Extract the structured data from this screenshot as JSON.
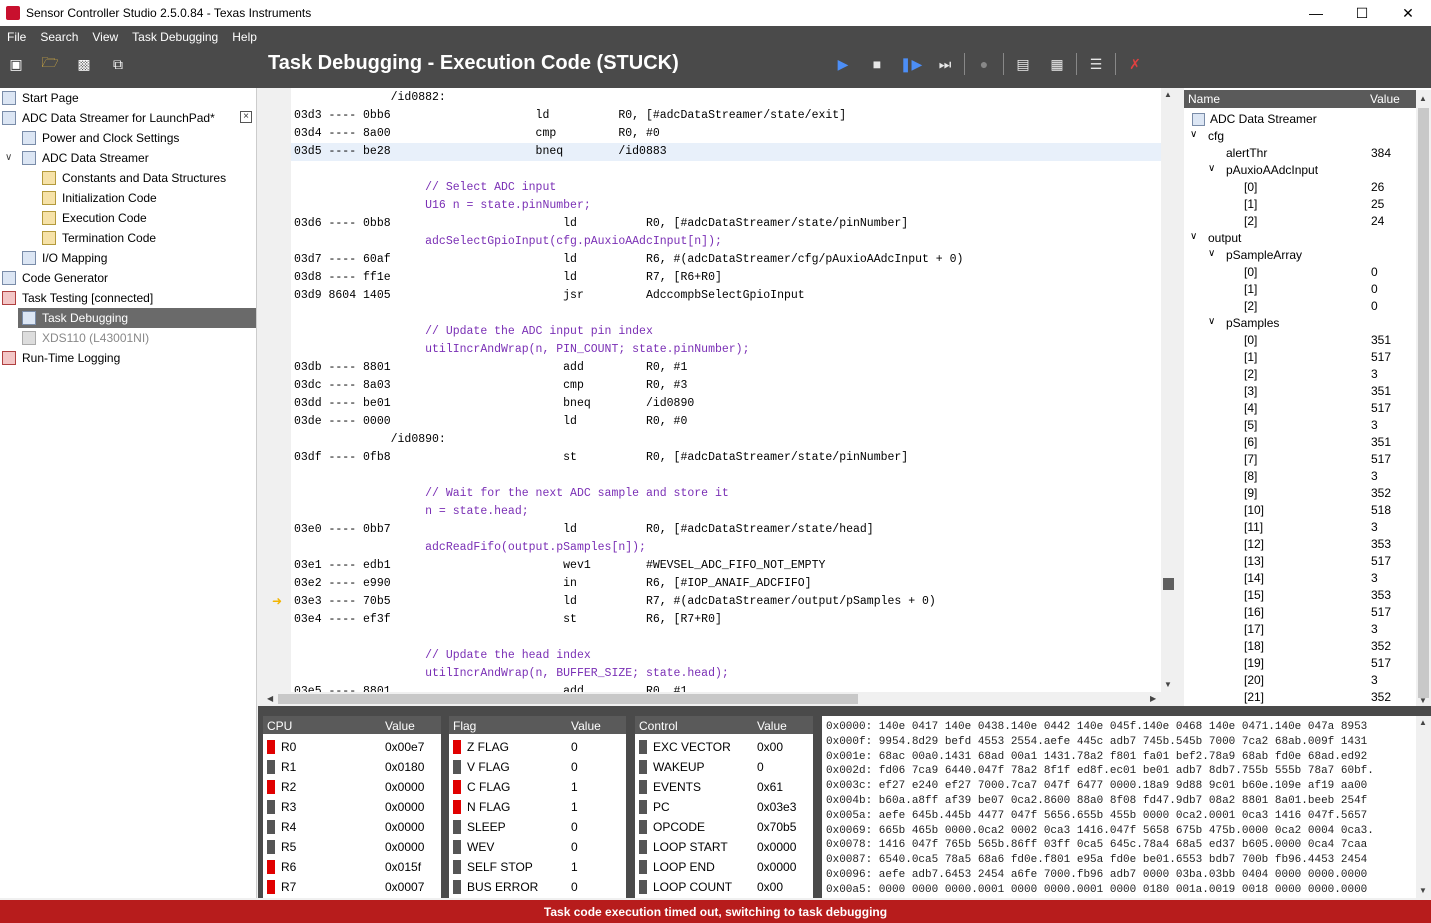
{
  "window": {
    "title": "Sensor Controller Studio 2.5.0.84 - Texas Instruments"
  },
  "menu": [
    "File",
    "Search",
    "View",
    "Task Debugging",
    "Help"
  ],
  "page_title": "Task Debugging - Execution Code (STUCK)",
  "tree": [
    {
      "label": "Start Page",
      "icon": "page-icon"
    },
    {
      "label": "ADC Data Streamer for LaunchPad*",
      "icon": "project-icon"
    },
    {
      "label": "Power and Clock Settings",
      "icon": "page-icon"
    },
    {
      "label": "ADC Data Streamer",
      "icon": "task-icon"
    },
    {
      "label": "Constants and Data Structures",
      "icon": "scroll-icon"
    },
    {
      "label": "Initialization Code",
      "icon": "scroll-icon"
    },
    {
      "label": "Execution Code",
      "icon": "scroll-icon"
    },
    {
      "label": "Termination Code",
      "icon": "scroll-icon"
    },
    {
      "label": "I/O Mapping",
      "icon": "io-icon"
    },
    {
      "label": "Code Generator",
      "icon": "page-icon"
    },
    {
      "label": "Task Testing [connected]",
      "icon": "chart-icon"
    },
    {
      "label": "Task Debugging",
      "icon": "debug-icon"
    },
    {
      "label": "XDS110 (L43001NI)",
      "icon": "device-icon"
    },
    {
      "label": "Run-Time Logging",
      "icon": "chart-icon"
    }
  ],
  "code_lines": [
    {
      "t": "              /id0882:",
      "c": false
    },
    {
      "t": "03d3 ---- 0bb6                     ld          R0, [#adcDataStreamer/state/exit]",
      "c": false
    },
    {
      "t": "03d4 ---- 8a00                     cmp         R0, #0",
      "c": false
    },
    {
      "t": "03d5 ---- be28                     bneq        /id0883",
      "c": false
    },
    {
      "t": "",
      "c": false
    },
    {
      "t": "                   // Select ADC input",
      "c": true
    },
    {
      "t": "                   U16 n = state.pinNumber;",
      "c": true
    },
    {
      "t": "03d6 ---- 0bb8                         ld          R0, [#adcDataStreamer/state/pinNumber]",
      "c": false
    },
    {
      "t": "                   adcSelectGpioInput(cfg.pAuxioAAdcInput[n]);",
      "c": true
    },
    {
      "t": "03d7 ---- 60af                         ld          R6, #(adcDataStreamer/cfg/pAuxioAAdcInput + 0)",
      "c": false
    },
    {
      "t": "03d8 ---- ff1e                         ld          R7, [R6+R0]",
      "c": false
    },
    {
      "t": "03d9 8604 1405                         jsr         AdccompbSelectGpioInput",
      "c": false
    },
    {
      "t": "",
      "c": false
    },
    {
      "t": "                   // Update the ADC input pin index",
      "c": true
    },
    {
      "t": "                   utilIncrAndWrap(n, PIN_COUNT; state.pinNumber);",
      "c": true
    },
    {
      "t": "03db ---- 8801                         add         R0, #1",
      "c": false
    },
    {
      "t": "03dc ---- 8a03                         cmp         R0, #3",
      "c": false
    },
    {
      "t": "03dd ---- be01                         bneq        /id0890",
      "c": false
    },
    {
      "t": "03de ---- 0000                         ld          R0, #0",
      "c": false
    },
    {
      "t": "              /id0890:",
      "c": false
    },
    {
      "t": "03df ---- 0fb8                         st          R0, [#adcDataStreamer/state/pinNumber]",
      "c": false
    },
    {
      "t": "",
      "c": false
    },
    {
      "t": "                   // Wait for the next ADC sample and store it",
      "c": true
    },
    {
      "t": "                   n = state.head;",
      "c": true
    },
    {
      "t": "03e0 ---- 0bb7                         ld          R0, [#adcDataStreamer/state/head]",
      "c": false
    },
    {
      "t": "                   adcReadFifo(output.pSamples[n]);",
      "c": true
    },
    {
      "t": "03e1 ---- edb1                         wev1        #WEVSEL_ADC_FIFO_NOT_EMPTY",
      "c": false
    },
    {
      "t": "03e2 ---- e990                         in          R6, [#IOP_ANAIF_ADCFIFO]",
      "c": false
    },
    {
      "t": "03e3 ---- 70b5                         ld          R7, #(adcDataStreamer/output/pSamples + 0)",
      "c": false
    },
    {
      "t": "03e4 ---- ef3f                         st          R6, [R7+R0]",
      "c": false
    },
    {
      "t": "",
      "c": false
    },
    {
      "t": "                   // Update the head index",
      "c": true
    },
    {
      "t": "                   utilIncrAndWrap(n, BUFFER_SIZE; state.head);",
      "c": true
    },
    {
      "t": "03e5 ---- 8801                         add         R0, #1",
      "c": false
    }
  ],
  "watch": {
    "col_name": "Name",
    "col_value": "Value",
    "rows": [
      {
        "n": "ADC Data Streamer",
        "v": "",
        "d": 0,
        "icon": true
      },
      {
        "n": "cfg",
        "v": "",
        "d": 0,
        "exp": true
      },
      {
        "n": "alertThr",
        "v": "384",
        "d": 2
      },
      {
        "n": "pAuxioAAdcInput",
        "v": "",
        "d": 1,
        "exp": true
      },
      {
        "n": "[0]",
        "v": "26",
        "d": 3
      },
      {
        "n": "[1]",
        "v": "25",
        "d": 3
      },
      {
        "n": "[2]",
        "v": "24",
        "d": 3
      },
      {
        "n": "output",
        "v": "",
        "d": 0,
        "exp": true
      },
      {
        "n": "pSampleArray",
        "v": "",
        "d": 1,
        "exp": true
      },
      {
        "n": "[0]",
        "v": "0",
        "d": 3
      },
      {
        "n": "[1]",
        "v": "0",
        "d": 3
      },
      {
        "n": "[2]",
        "v": "0",
        "d": 3
      },
      {
        "n": "pSamples",
        "v": "",
        "d": 1,
        "exp": true
      },
      {
        "n": "[0]",
        "v": "351",
        "d": 3
      },
      {
        "n": "[1]",
        "v": "517",
        "d": 3
      },
      {
        "n": "[2]",
        "v": "3",
        "d": 3
      },
      {
        "n": "[3]",
        "v": "351",
        "d": 3
      },
      {
        "n": "[4]",
        "v": "517",
        "d": 3
      },
      {
        "n": "[5]",
        "v": "3",
        "d": 3
      },
      {
        "n": "[6]",
        "v": "351",
        "d": 3
      },
      {
        "n": "[7]",
        "v": "517",
        "d": 3
      },
      {
        "n": "[8]",
        "v": "3",
        "d": 3
      },
      {
        "n": "[9]",
        "v": "352",
        "d": 3
      },
      {
        "n": "[10]",
        "v": "518",
        "d": 3
      },
      {
        "n": "[11]",
        "v": "3",
        "d": 3
      },
      {
        "n": "[12]",
        "v": "353",
        "d": 3
      },
      {
        "n": "[13]",
        "v": "517",
        "d": 3
      },
      {
        "n": "[14]",
        "v": "3",
        "d": 3
      },
      {
        "n": "[15]",
        "v": "353",
        "d": 3
      },
      {
        "n": "[16]",
        "v": "517",
        "d": 3
      },
      {
        "n": "[17]",
        "v": "3",
        "d": 3
      },
      {
        "n": "[18]",
        "v": "352",
        "d": 3
      },
      {
        "n": "[19]",
        "v": "517",
        "d": 3
      },
      {
        "n": "[20]",
        "v": "3",
        "d": 3
      },
      {
        "n": "[21]",
        "v": "352",
        "d": 3
      }
    ]
  },
  "cpu": {
    "col_name": "CPU",
    "col_value": "Value",
    "rows": [
      {
        "n": "R0",
        "v": "0x00e7",
        "on": true
      },
      {
        "n": "R1",
        "v": "0x0180",
        "on": false
      },
      {
        "n": "R2",
        "v": "0x0000",
        "on": true
      },
      {
        "n": "R3",
        "v": "0x0000",
        "on": false
      },
      {
        "n": "R4",
        "v": "0x0000",
        "on": false
      },
      {
        "n": "R5",
        "v": "0x0000",
        "on": false
      },
      {
        "n": "R6",
        "v": "0x015f",
        "on": true
      },
      {
        "n": "R7",
        "v": "0x0007",
        "on": true
      }
    ]
  },
  "flags": {
    "col_name": "Flag",
    "col_value": "Value",
    "rows": [
      {
        "n": "Z FLAG",
        "v": "0",
        "on": true
      },
      {
        "n": "V FLAG",
        "v": "0",
        "on": false
      },
      {
        "n": "C FLAG",
        "v": "1",
        "on": true
      },
      {
        "n": "N FLAG",
        "v": "1",
        "on": true
      },
      {
        "n": "SLEEP",
        "v": "0",
        "on": false
      },
      {
        "n": "WEV",
        "v": "0",
        "on": false
      },
      {
        "n": "SELF STOP",
        "v": "1",
        "on": false
      },
      {
        "n": "BUS ERROR",
        "v": "0",
        "on": false
      }
    ]
  },
  "control": {
    "col_name": "Control",
    "col_value": "Value",
    "rows": [
      {
        "n": "EXC VECTOR",
        "v": "0x00",
        "on": false
      },
      {
        "n": "WAKEUP",
        "v": "0",
        "on": false
      },
      {
        "n": "EVENTS",
        "v": "0x61",
        "on": false
      },
      {
        "n": "PC",
        "v": "0x03e3",
        "on": false
      },
      {
        "n": "OPCODE",
        "v": "0x70b5",
        "on": false
      },
      {
        "n": "LOOP START",
        "v": "0x0000",
        "on": false
      },
      {
        "n": "LOOP END",
        "v": "0x0000",
        "on": false
      },
      {
        "n": "LOOP COUNT",
        "v": "0x00",
        "on": false
      }
    ]
  },
  "hex": [
    "0x0000: 140e 0417 140e 0438.140e 0442 140e 045f.140e 0468 140e 0471.140e 047a 8953",
    "0x000f: 9954.8d29 befd 4553 2554.aefe 445c adb7 745b.545b 7000 7ca2 68ab.009f 1431",
    "0x001e: 68ac 00a0.1431 68ad 00a1 1431.78a2 f801 fa01 bef2.78a9 68ab fd0e 68ad.ed92",
    "0x002d: fd06 7ca9 6440.047f 78a2 8f1f ed8f.ec01 be01 adb7 8db7.755b 555b 78a7 60bf.",
    "0x003c: ef27 e240 ef27 7000.7ca7 047f 6477 0000.18a9 9d88 9c01 b60e.109e af19 aa00",
    "0x004b: b60a.a8ff af39 be07 0ca2.8600 88a0 8f08 fd47.9db7 08a2 8801 8a01.beeb 254f",
    "0x005a: aefe 645b.445b 4477 047f 5656.655b 455b 0000 0ca2.0001 0ca3 1416 047f.5657",
    "0x0069: 665b 465b 0000.0ca2 0002 0ca3 1416.047f 5658 675b 475b.0000 0ca2 0004 0ca3.",
    "0x0078: 1416 047f 765b 565b.86ff 03ff 0ca5 645c.78a4 68a5 ed37 b605.0000 0ca4 7caa",
    "0x0087: 6540.0ca5 78a5 68a6 fd0e.f801 e95a fd0e be01.6553 bdb7 700b fb96.4453 2454",
    "0x0096: aefe adb7.6453 2454 a6fe 7000.fb96 adb7 0000 03ba.03bb 0404 0000 0000.0000",
    "0x00a5: 0000 0000 0000.0001 0000 0000.0001 0000 0180 001a.0019 0018 0000 0000.0000"
  ],
  "status": "Task code execution timed out, switching to task debugging"
}
